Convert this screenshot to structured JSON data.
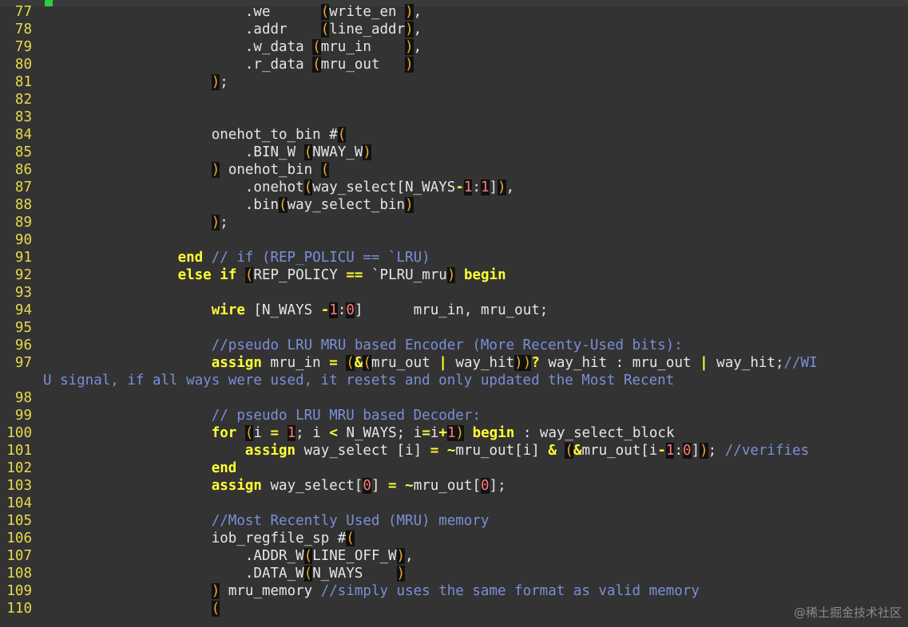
{
  "editor": {
    "lines": [
      {
        "n": "77",
        "t": "        .we      (write_en ),"
      },
      {
        "n": "78",
        "t": "        .addr    (line_addr),"
      },
      {
        "n": "79",
        "t": "        .w_data (mru_in    ),"
      },
      {
        "n": "80",
        "t": "        .r_data (mru_out   )"
      },
      {
        "n": "81",
        "t": "    );"
      },
      {
        "n": "82",
        "t": ""
      },
      {
        "n": "83",
        "t": ""
      },
      {
        "n": "84",
        "t": "    onehot_to_bin #("
      },
      {
        "n": "85",
        "t": "        .BIN_W (NWAY_W)"
      },
      {
        "n": "86",
        "t": "    ) onehot_bin ("
      },
      {
        "n": "87",
        "t": "        .onehot(way_select[N_WAYS-1:1]),"
      },
      {
        "n": "88",
        "t": "        .bin(way_select_bin)"
      },
      {
        "n": "89",
        "t": "    );"
      },
      {
        "n": "90",
        "t": ""
      },
      {
        "n": "91",
        "t": "end // if (REP_POLICU == `LRU)"
      },
      {
        "n": "92",
        "t": "else if (REP_POLICY == `PLRU_mru) begin"
      },
      {
        "n": "93",
        "t": ""
      },
      {
        "n": "94",
        "t": "    wire [N_WAYS -1:0]      mru_in, mru_out;"
      },
      {
        "n": "95",
        "t": ""
      },
      {
        "n": "96",
        "t": "    //pseudo LRU MRU based Encoder (More Recenty-Used bits):"
      },
      {
        "n": "97",
        "t": "    assign mru_in = (&(mru_out | way_hit))? way_hit : mru_out | way_hit;//WI"
      },
      {
        "n": "",
        "t": "U signal, if all ways were used, it resets and only updated the Most Recent"
      },
      {
        "n": "98",
        "t": ""
      },
      {
        "n": "99",
        "t": "    // pseudo LRU MRU based Decoder:"
      },
      {
        "n": "100",
        "t": "    for (i = 1; i < N_WAYS; i=i+1) begin : way_select_block"
      },
      {
        "n": "101",
        "t": "        assign way_select [i] = ~mru_out[i] & (&mru_out[i-1:0]); //verifies"
      },
      {
        "n": "102",
        "t": "    end"
      },
      {
        "n": "103",
        "t": "    assign way_select[0] = ~mru_out[0];"
      },
      {
        "n": "104",
        "t": ""
      },
      {
        "n": "105",
        "t": "    //Most Recently Used (MRU) memory"
      },
      {
        "n": "106",
        "t": "    iob_regfile_sp #("
      },
      {
        "n": "107",
        "t": "        .ADDR_W(LINE_OFF_W),"
      },
      {
        "n": "108",
        "t": "        .DATA_W(N_WAYS    )"
      },
      {
        "n": "109",
        "t": "    ) mru_memory //simply uses the same format as valid memory"
      },
      {
        "n": "110",
        "t": "    ("
      }
    ]
  },
  "watermark": "@稀土掘金技术社区",
  "colors": {
    "background": "#333333",
    "line_number": "#e6db4a",
    "keyword": "#ffff33",
    "comment": "#7a8fd8",
    "paren_highlight": "#f0a830",
    "number": "#ff7b7b",
    "text": "#e6e6e6"
  }
}
